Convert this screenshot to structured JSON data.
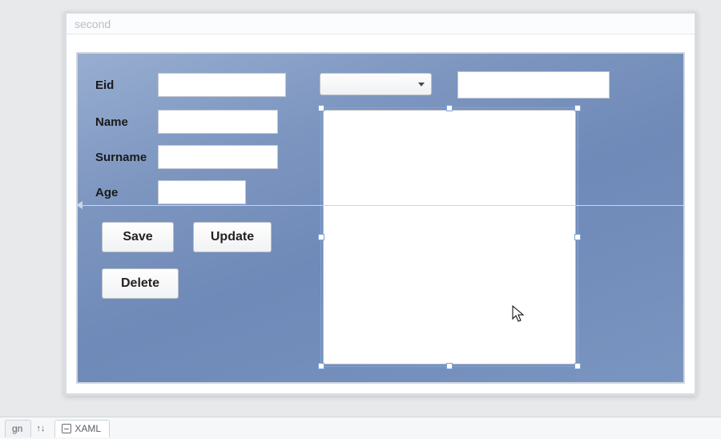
{
  "window": {
    "title": "second"
  },
  "labels": {
    "eid": "Eid",
    "name": "Name",
    "surname": "Surname",
    "age": "Age"
  },
  "fields": {
    "eid": "",
    "name": "",
    "surname": "",
    "age": "",
    "combo_selected": "",
    "right_text": ""
  },
  "buttons": {
    "save": "Save",
    "update": "Update",
    "delete": "Delete"
  },
  "tabs": {
    "design": "gn",
    "xaml": "XAML"
  }
}
